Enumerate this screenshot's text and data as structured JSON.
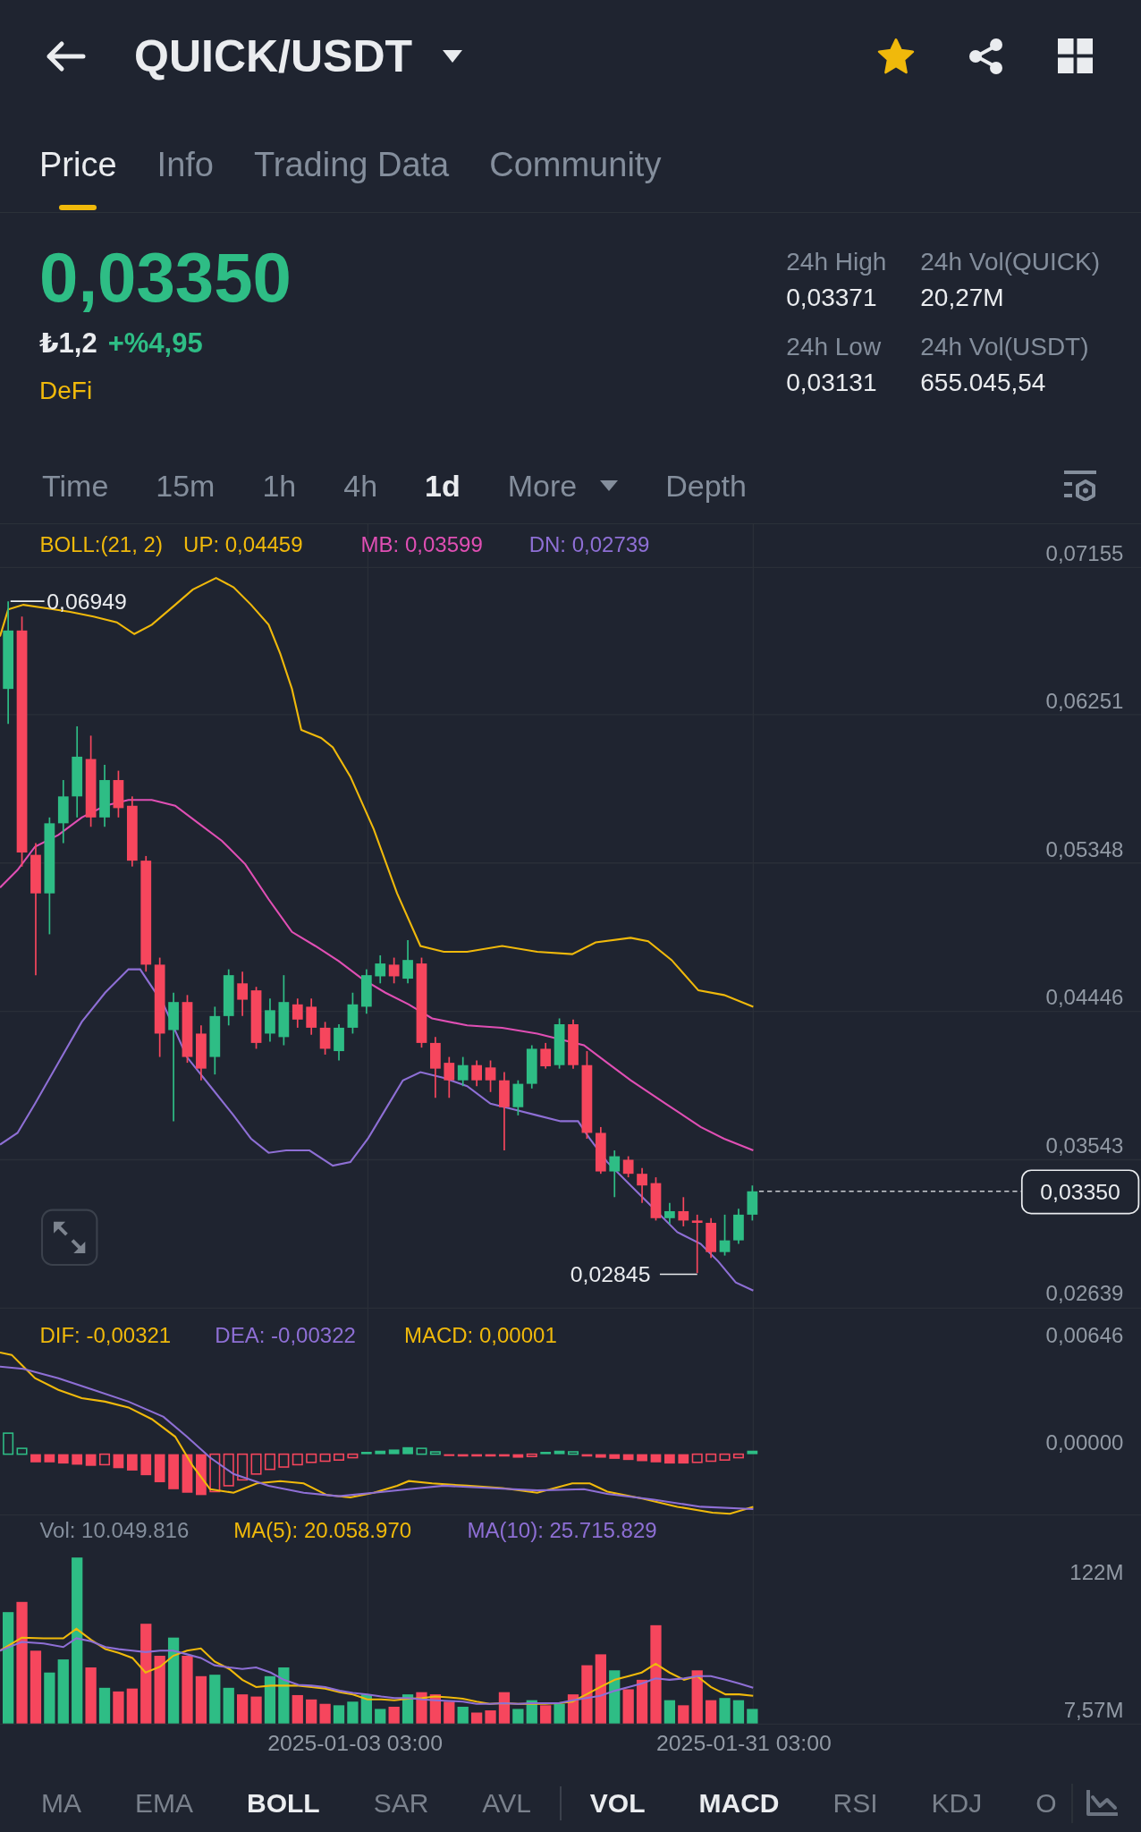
{
  "header": {
    "title": "QUICK/USDT",
    "favorite": true
  },
  "tabs": [
    {
      "label": "Price",
      "selected": true
    },
    {
      "label": "Info",
      "selected": false
    },
    {
      "label": "Trading Data",
      "selected": false
    },
    {
      "label": "Community",
      "selected": false
    }
  ],
  "ticker": {
    "price": "0,03350",
    "fiat_value": "₺1,2",
    "change": "+%4,95",
    "rising": true,
    "category": "DeFi",
    "stats": [
      {
        "label": "24h High",
        "value": "0,03371"
      },
      {
        "label": "24h Vol(QUICK)",
        "value": "20,27M"
      },
      {
        "label": "24h Low",
        "value": "0,03131"
      },
      {
        "label": "24h Vol(USDT)",
        "value": "655.045,54"
      }
    ]
  },
  "intervals": [
    {
      "label": "Time",
      "selected": false,
      "kind": "option"
    },
    {
      "label": "15m",
      "selected": false,
      "kind": "option"
    },
    {
      "label": "1h",
      "selected": false,
      "kind": "option"
    },
    {
      "label": "4h",
      "selected": false,
      "kind": "option"
    },
    {
      "label": "1d",
      "selected": true,
      "kind": "option"
    },
    {
      "label": "More",
      "selected": false,
      "kind": "menu"
    },
    {
      "label": "Depth",
      "selected": false,
      "kind": "option"
    }
  ],
  "price_chart": {
    "legend": [
      {
        "text": "BOLL:(21, 2)",
        "color": "#f0b90b"
      },
      {
        "text": "UP: 0,04459",
        "color": "#f0b90b"
      },
      {
        "text": "MB: 0,03599",
        "color": "#e04fb4"
      },
      {
        "text": "DN: 0,02739",
        "color": "#8e6fd5"
      }
    ],
    "axis_labels": [
      "0,07155",
      "0,06251",
      "0,05348",
      "0,04446",
      "0,03543",
      "0,02639"
    ],
    "high_label": "0,06949",
    "low_label": "0,02845",
    "last_price": "0,03350"
  },
  "macd_chart": {
    "legend": [
      {
        "text": "DIF: -0,00321",
        "color": "#f0b90b"
      },
      {
        "text": "DEA: -0,00322",
        "color": "#8e6fd5"
      },
      {
        "text": "MACD: 0,00001",
        "color": "#f0b90b"
      }
    ],
    "axis_labels": [
      "0,00646",
      "0,00000"
    ]
  },
  "volume_chart": {
    "legend": [
      {
        "text": "Vol: 10.049.816",
        "color": "#848e9c"
      },
      {
        "text": "MA(5): 20.058.970",
        "color": "#f0b90b"
      },
      {
        "text": "MA(10): 25.715.829",
        "color": "#8e6fd5"
      }
    ],
    "axis_labels": [
      "122M",
      "7,57M"
    ]
  },
  "time_axis": [
    "2025-01-03 03:00",
    "2025-01-31 03:00"
  ],
  "indicators": {
    "main": [
      {
        "label": "MA",
        "selected": false
      },
      {
        "label": "EMA",
        "selected": false
      },
      {
        "label": "BOLL",
        "selected": true
      },
      {
        "label": "SAR",
        "selected": false
      },
      {
        "label": "AVL",
        "selected": false
      }
    ],
    "sub": [
      {
        "label": "VOL",
        "selected": true
      },
      {
        "label": "MACD",
        "selected": true
      },
      {
        "label": "RSI",
        "selected": false
      },
      {
        "label": "KDJ",
        "selected": false
      },
      {
        "label": "O",
        "selected": false
      }
    ]
  }
}
